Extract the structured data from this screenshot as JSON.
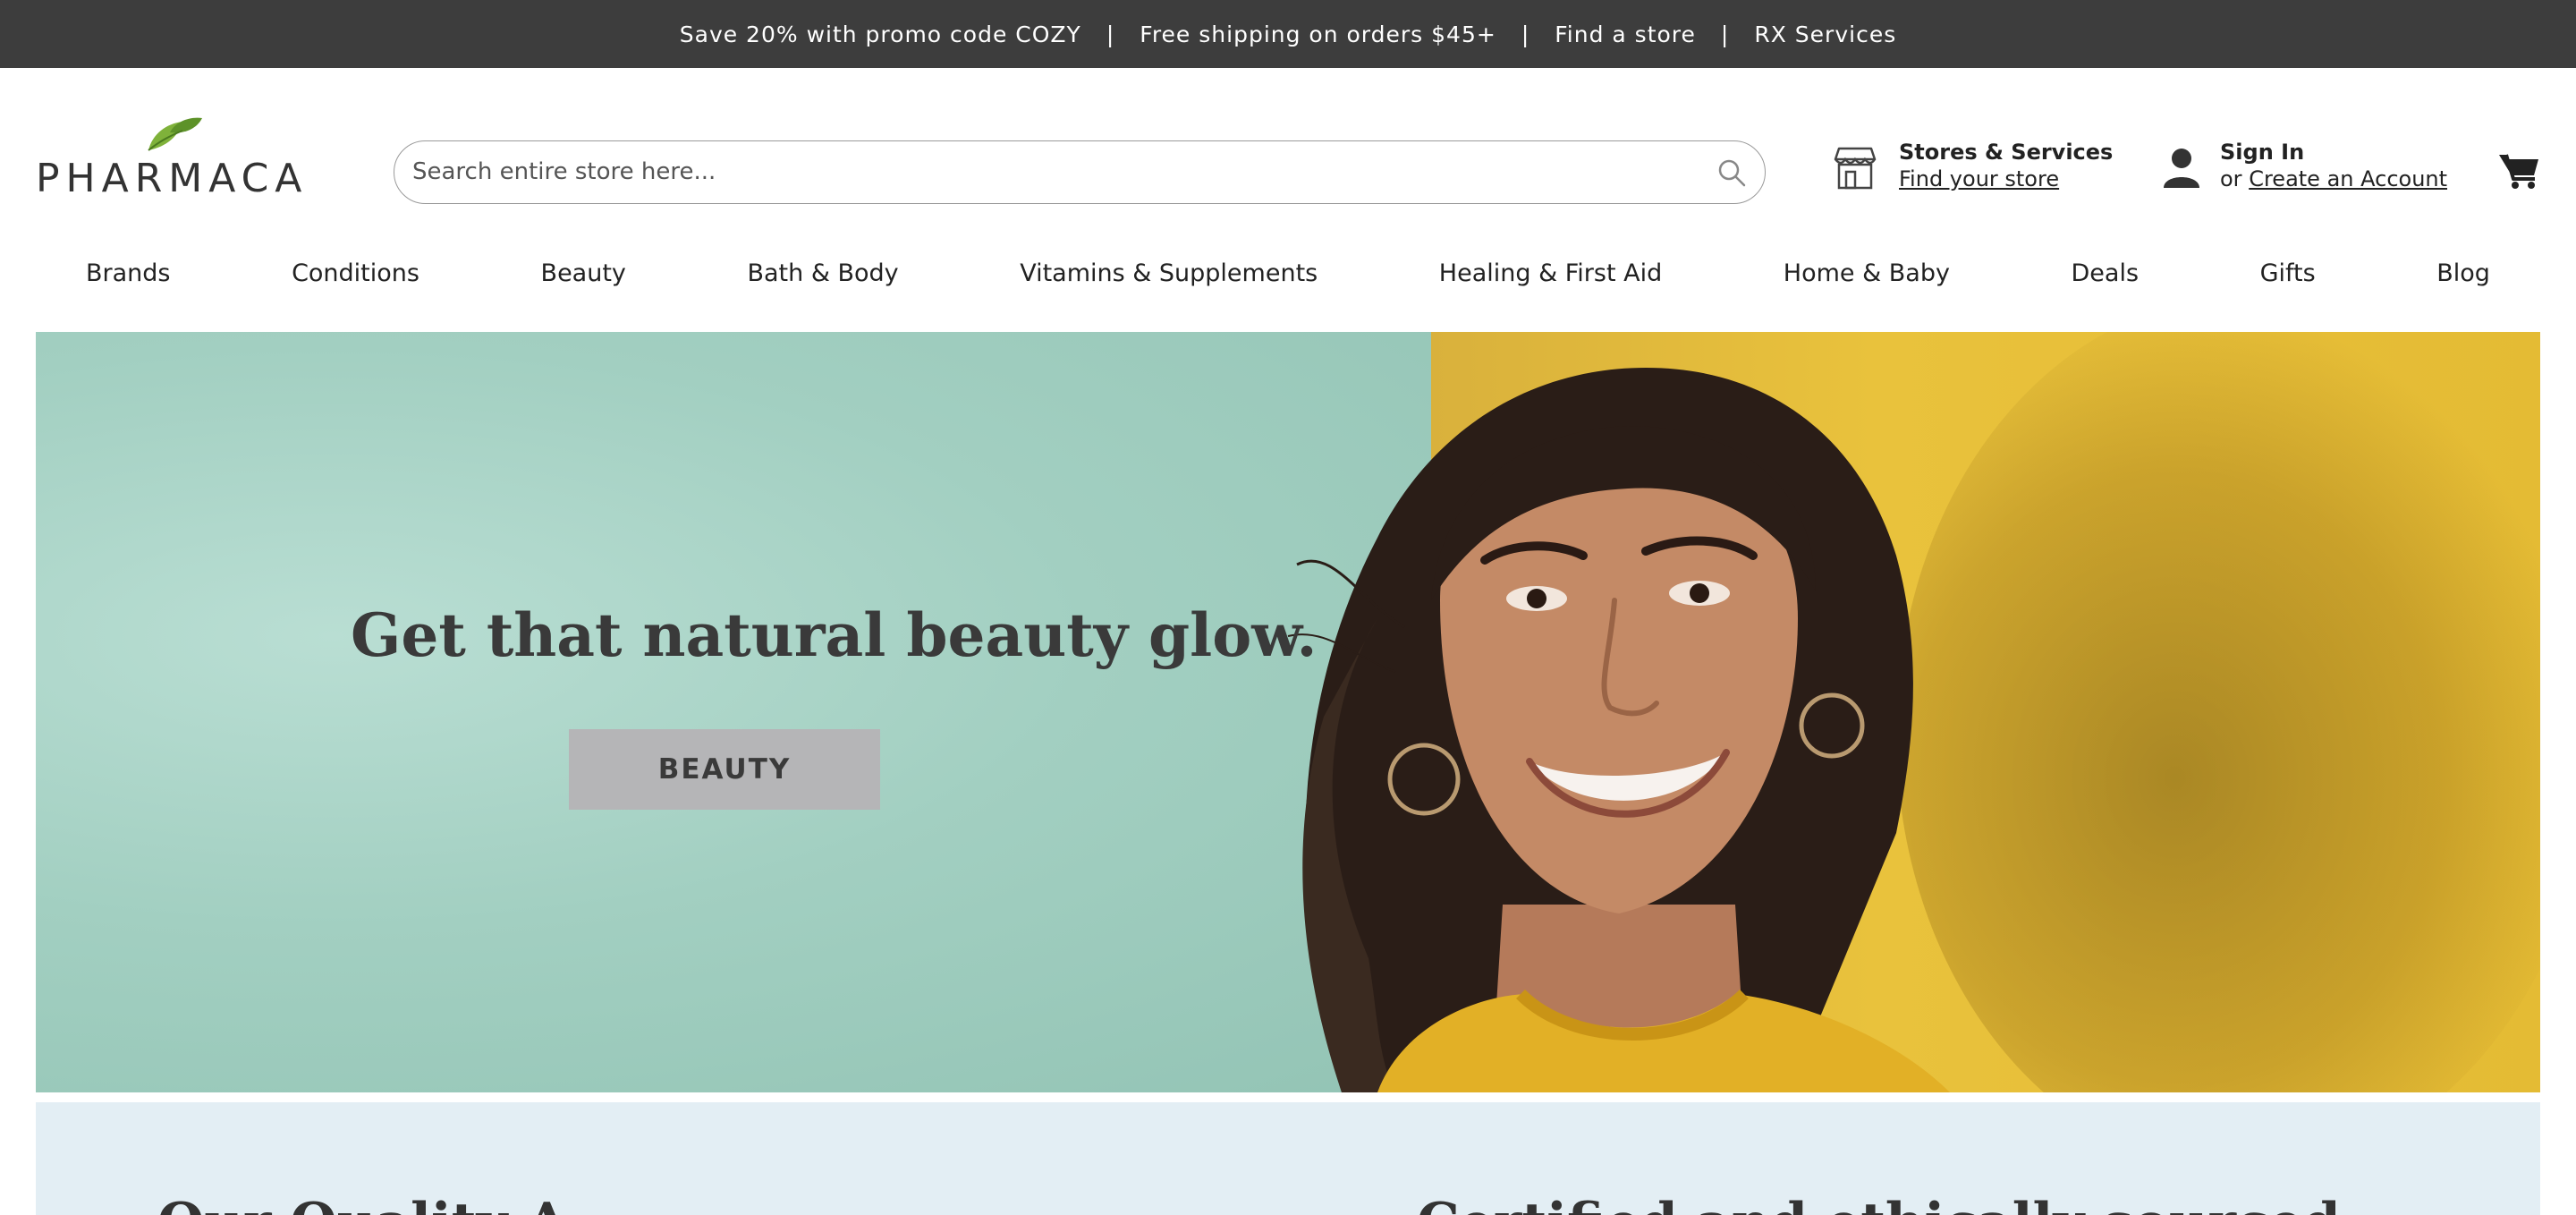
{
  "promo_bar": {
    "items": [
      "Save 20% with promo code COZY",
      "Free shipping on orders $45+",
      "Find a store",
      "RX Services"
    ],
    "separator": "|"
  },
  "header": {
    "logo_text": "PHARMACA",
    "search": {
      "placeholder": "Search entire store here..."
    },
    "stores": {
      "title": "Stores & Services",
      "link": "Find your store"
    },
    "account": {
      "title": "Sign In",
      "prefix": "or",
      "link": "Create an Account"
    }
  },
  "nav": {
    "items": [
      "Brands",
      "Conditions",
      "Beauty",
      "Bath & Body",
      "Vitamins & Supplements",
      "Healing & First Aid",
      "Home & Baby",
      "Deals",
      "Gifts",
      "Blog"
    ]
  },
  "hero": {
    "headline": "Get that natural beauty glow.",
    "cta_label": "BEAUTY"
  },
  "quality": {
    "heading_left": "Our Quality A",
    "heading_right": "Certified and ethically sourced"
  },
  "colors": {
    "promo_bg": "#3d3d3d",
    "brand_green": "#6aa332",
    "hero_wall_green": "#a7d3c6",
    "hero_wall_yellow": "#e4bb34",
    "cta_bg": "#b5b5b7",
    "quality_bg": "#e3eef4"
  }
}
